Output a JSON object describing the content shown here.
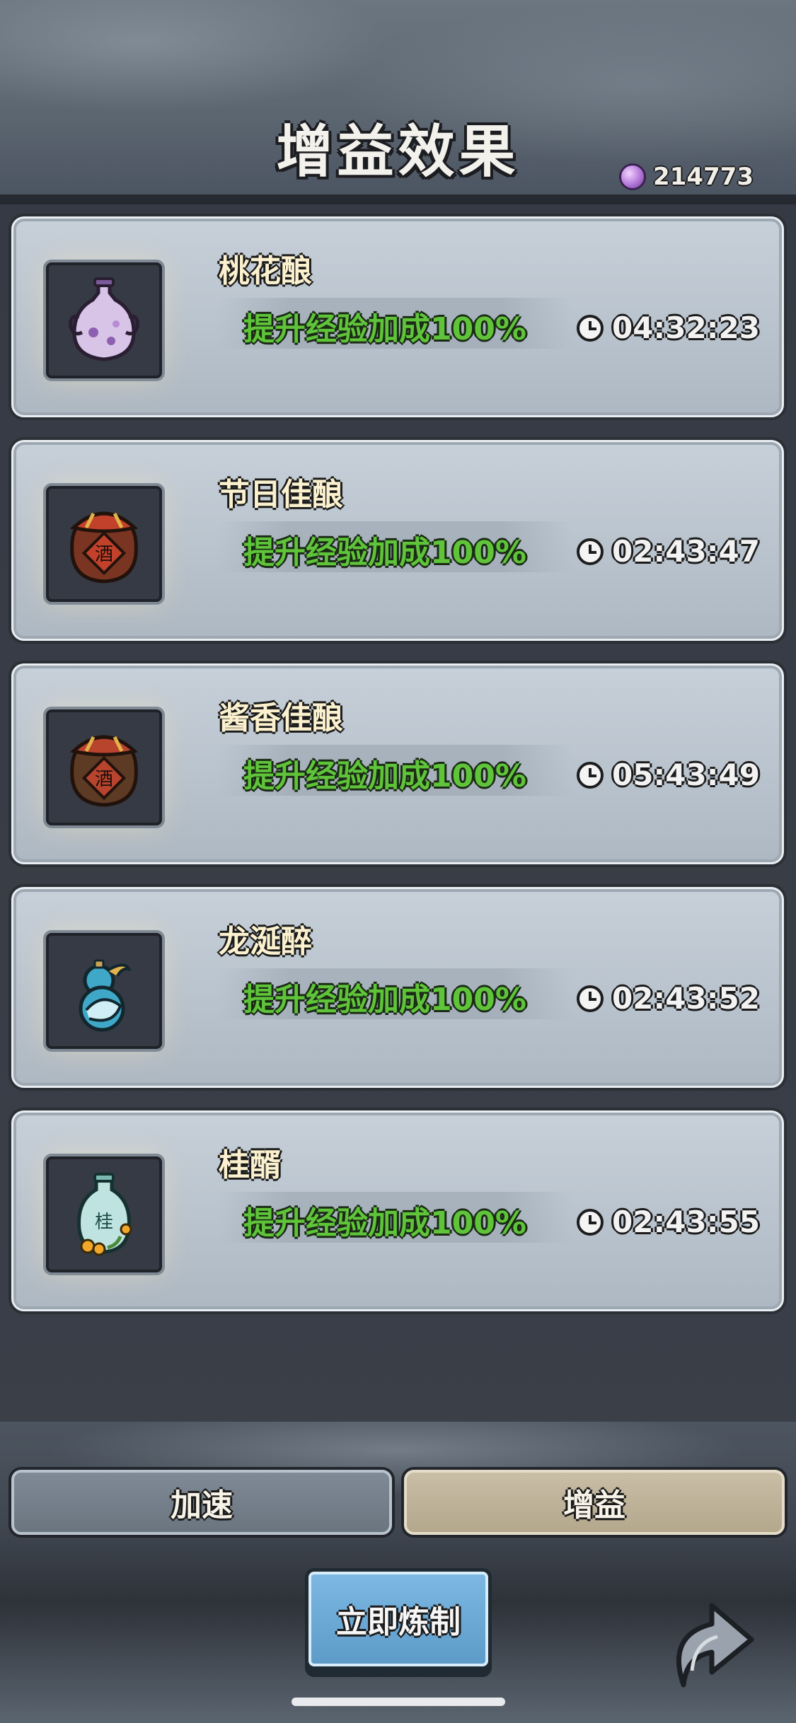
{
  "header": {
    "title": "增益效果",
    "currency": {
      "icon": "purple-gem-icon",
      "value": "214773"
    }
  },
  "buffs": [
    {
      "name": "桃花酿",
      "effect": "提升经验加成100%",
      "time_left": "04:32:23",
      "icon": "peach-blossom-wine-vase-icon"
    },
    {
      "name": "节日佳酿",
      "effect": "提升经验加成100%",
      "time_left": "02:43:47",
      "icon": "festival-wine-jar-icon",
      "jar_label": "酒"
    },
    {
      "name": "酱香佳酿",
      "effect": "提升经验加成100%",
      "time_left": "05:43:49",
      "icon": "soy-fragrance-wine-jar-icon",
      "jar_label": "酒"
    },
    {
      "name": "龙涎醉",
      "effect": "提升经验加成100%",
      "time_left": "02:43:52",
      "icon": "dragon-gourd-icon"
    },
    {
      "name": "桂醑",
      "effect": "提升经验加成100%",
      "time_left": "02:43:55",
      "icon": "osmanthus-wine-bottle-icon",
      "bottle_label": "桂"
    }
  ],
  "tabs": [
    {
      "label": "加速",
      "active": false
    },
    {
      "label": "增益",
      "active": true
    }
  ],
  "actions": {
    "refine_now": "立即炼制"
  },
  "colors": {
    "effect_text": "#5fc43a",
    "name_text": "#fbf1cf",
    "card_bg": "#bdc6cf",
    "button_blue": "#6fabd6"
  }
}
